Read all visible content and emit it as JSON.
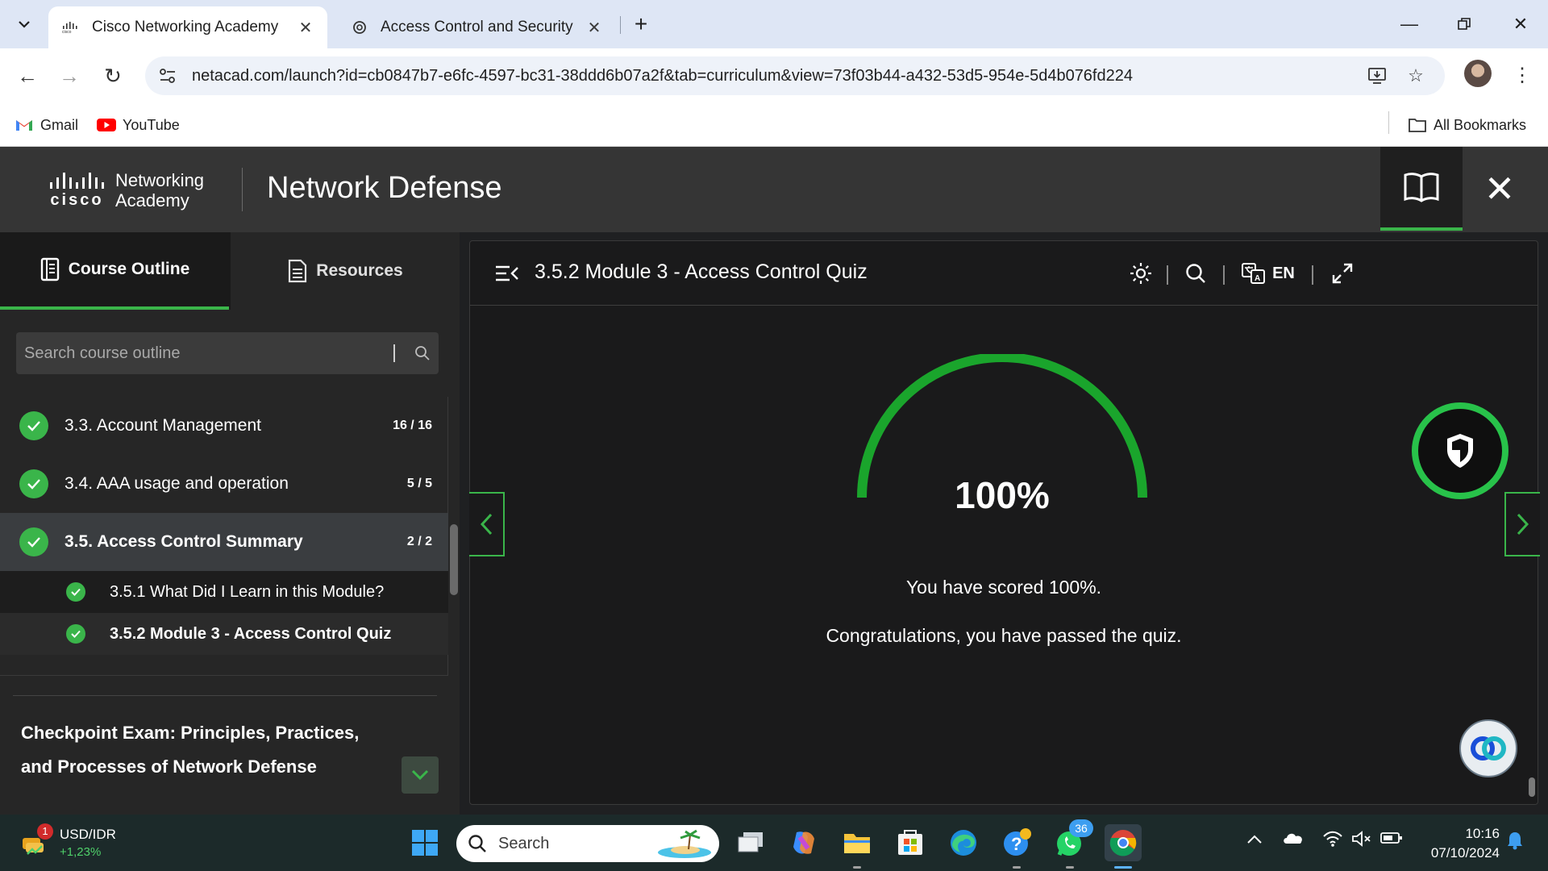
{
  "browser": {
    "tabs": [
      {
        "title": "Cisco Networking Academy",
        "active": true
      },
      {
        "title": "Access Control and Security",
        "active": false
      }
    ],
    "url": "netacad.com/launch?id=cb0847b7-e6fc-4597-bc31-38ddd6b07a2f&tab=curriculum&view=73f03b44-a432-53d5-954e-5d4b076fd224",
    "bookmarks": [
      {
        "label": "Gmail",
        "icon": "gmail-icon"
      },
      {
        "label": "YouTube",
        "icon": "youtube-icon"
      }
    ],
    "all_bookmarks": "All Bookmarks"
  },
  "app": {
    "logo_line1": "Networking",
    "logo_line2": "Academy",
    "logo_word": "cisco",
    "course_title": "Network Defense"
  },
  "sidebar": {
    "tabs": [
      {
        "label": "Course Outline",
        "active": true
      },
      {
        "label": "Resources",
        "active": false
      }
    ],
    "search_placeholder": "Search course outline",
    "items": [
      {
        "label": "3.3. Account Management",
        "count": "16 / 16",
        "selected": false
      },
      {
        "label": "3.4. AAA usage and operation",
        "count": "5 / 5",
        "selected": false
      },
      {
        "label": "3.5. Access Control Summary",
        "count": "2 / 2",
        "selected": true
      }
    ],
    "subitems": [
      {
        "label": "3.5.1 What Did I Learn in this Module?",
        "current": false
      },
      {
        "label": "3.5.2 Module 3 - Access Control Quiz",
        "current": true
      }
    ],
    "checkpoint": "Checkpoint Exam: Principles, Practices, and Processes of Network Defense"
  },
  "content": {
    "title": "3.5.2 Module 3 - Access Control Quiz",
    "language": "EN",
    "score_percent": 100,
    "score_label": "100%",
    "message1": "You have scored 100%.",
    "message2": "Congratulations, you have passed the quiz."
  },
  "taskbar": {
    "widget_title": "USD/IDR",
    "widget_value": "+1,23%",
    "widget_badge": "1",
    "search_label": "Search",
    "whatsapp_badge": "36",
    "time": "10:16",
    "date": "07/10/2024"
  },
  "colors": {
    "accent_green": "#3ab54a",
    "header_bg": "#353535",
    "content_bg": "#1a1a1b"
  }
}
